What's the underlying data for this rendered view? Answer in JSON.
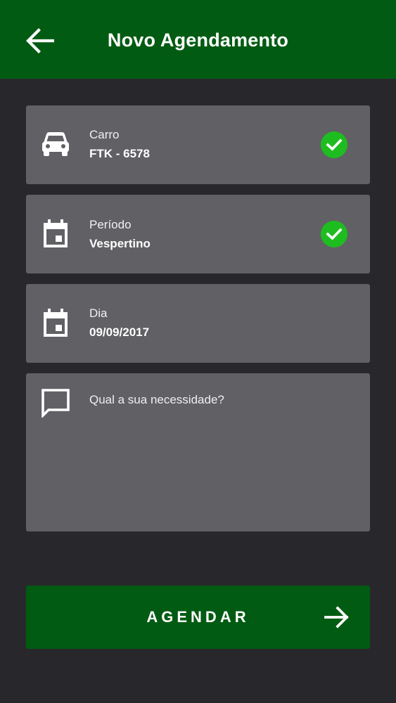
{
  "header": {
    "title": "Novo Agendamento",
    "back_icon": "arrow-left-icon"
  },
  "cards": {
    "car": {
      "label": "Carro",
      "value": "FTK - 6578",
      "icon": "car-icon",
      "status": "confirmed"
    },
    "period": {
      "label": "Período",
      "value": "Vespertino",
      "icon": "calendar-icon",
      "status": "confirmed"
    },
    "day": {
      "label": "Dia",
      "value": "09/09/2017",
      "icon": "calendar-icon"
    },
    "notes": {
      "placeholder": "Qual a sua necessidade?",
      "icon": "chat-bubble-icon"
    }
  },
  "submit": {
    "label": "AGENDAR",
    "icon": "arrow-right-icon"
  },
  "colors": {
    "brand_green": "#015b12",
    "background": "#28282c",
    "card": "#606065",
    "check": "#1ebd1f"
  }
}
